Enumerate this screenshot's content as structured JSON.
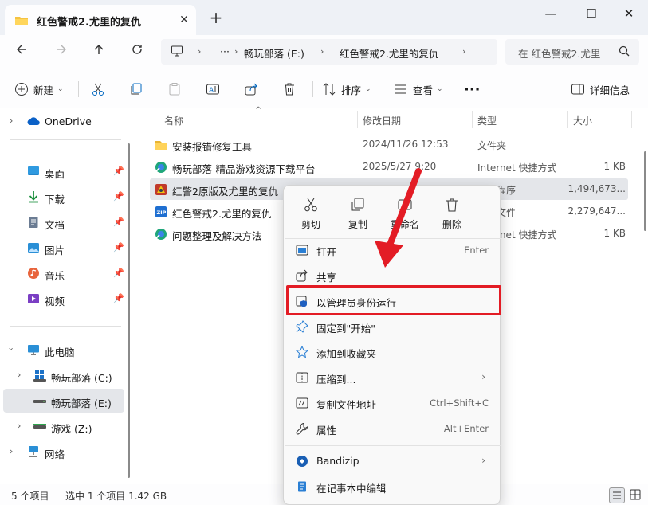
{
  "window": {
    "tab_title": "红色警戒2.尤里的复仇",
    "new_tab_label": "+",
    "close_tab_label": "✕",
    "minimize_label": "—",
    "maximize_label": "☐",
    "close_label": "✕"
  },
  "address": {
    "more_label": "···",
    "crumbs": [
      "畅玩部落 (E:)",
      "红色警戒2.尤里的复仇"
    ],
    "search_placeholder": "在 红色警戒2.尤里"
  },
  "toolbar": {
    "new_label": "新建",
    "sort_label": "排序",
    "view_label": "查看",
    "more_label": "···",
    "details_label": "详细信息"
  },
  "sidebar": {
    "items": [
      {
        "label": "OneDrive",
        "icon": "cloud-icon"
      },
      {
        "label": "桌面",
        "icon": "desktop-icon"
      },
      {
        "label": "下载",
        "icon": "download-icon"
      },
      {
        "label": "文档",
        "icon": "document-icon"
      },
      {
        "label": "图片",
        "icon": "pictures-icon"
      },
      {
        "label": "音乐",
        "icon": "music-icon"
      },
      {
        "label": "视频",
        "icon": "video-icon"
      },
      {
        "label": "此电脑",
        "icon": "computer-icon"
      },
      {
        "label": "畅玩部落 (C:)",
        "icon": "drive-icon"
      },
      {
        "label": "畅玩部落 (E:)",
        "icon": "drive-icon"
      },
      {
        "label": "游戏 (Z:)",
        "icon": "drive-icon"
      },
      {
        "label": "网络",
        "icon": "network-icon"
      }
    ]
  },
  "columns": {
    "name": "名称",
    "date": "修改日期",
    "type": "类型",
    "size": "大小"
  },
  "files": [
    {
      "name": "安装报错修复工具",
      "date": "2024/11/26 12:53",
      "type": "文件夹",
      "size": "",
      "icon": "folder-icon"
    },
    {
      "name": "畅玩部落-精品游戏资源下载平台",
      "date": "2025/5/27 9:20",
      "type": "Internet 快捷方式",
      "size": "1 KB",
      "icon": "internet-shortcut-icon"
    },
    {
      "name": "红警2原版及尤里的复仇",
      "date": "",
      "type": "应用程序",
      "size": "1,494,673...",
      "icon": "application-icon"
    },
    {
      "name": "红色警戒2.尤里的复仇",
      "date": "",
      "type": "压缩文件",
      "size": "2,279,647...",
      "icon": "zip-archive-icon"
    },
    {
      "name": "问题整理及解决方法",
      "date": "",
      "type": "Internet 快捷方式",
      "size": "1 KB",
      "icon": "internet-shortcut-icon"
    }
  ],
  "status": {
    "item_count": "5 个项目",
    "selection": "选中 1 个项目  1.42 GB"
  },
  "context_menu": {
    "quick_actions": [
      {
        "label": "剪切",
        "icon": "scissors-icon"
      },
      {
        "label": "复制",
        "icon": "copy-icon"
      },
      {
        "label": "重命名",
        "icon": "rename-icon"
      },
      {
        "label": "删除",
        "icon": "trash-icon"
      }
    ],
    "items": [
      {
        "label": "打开",
        "shortcut": "Enter",
        "icon": "open-window-icon"
      },
      {
        "label": "共享",
        "shortcut": "",
        "icon": "share-icon"
      },
      {
        "label": "以管理员身份运行",
        "shortcut": "",
        "icon": "admin-shield-icon"
      },
      {
        "label": "固定到\"开始\"",
        "shortcut": "",
        "icon": "pin-icon"
      },
      {
        "label": "添加到收藏夹",
        "shortcut": "",
        "icon": "star-icon"
      },
      {
        "label": "压缩到...",
        "shortcut": "",
        "icon": "compress-icon"
      },
      {
        "label": "复制文件地址",
        "shortcut": "Ctrl+Shift+C",
        "icon": "copy-path-icon"
      },
      {
        "label": "属性",
        "shortcut": "Alt+Enter",
        "icon": "wrench-icon"
      },
      {
        "label": "Bandizip",
        "shortcut": "",
        "icon": "bandizip-icon"
      },
      {
        "label": "在记事本中编辑",
        "shortcut": "",
        "icon": "notepad-icon"
      }
    ]
  },
  "colors": {
    "highlight_border": "#e31c25",
    "arrow": "#e31c25",
    "folder": "#f5c342",
    "accent": "#0067c0"
  }
}
